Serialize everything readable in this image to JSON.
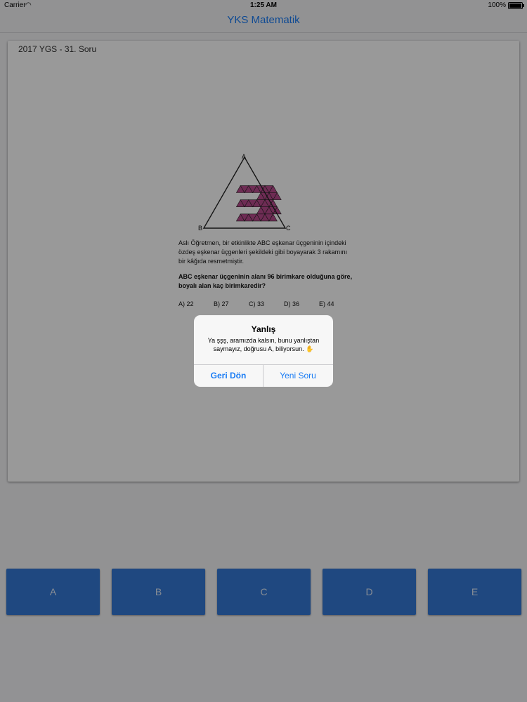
{
  "status_bar": {
    "carrier": "Carrier",
    "time": "1:25 AM",
    "battery": "100%"
  },
  "nav": {
    "title": "YKS Matematik"
  },
  "question_card": {
    "header": "2017 YGS - 31. Soru",
    "figure_labels": {
      "a": "A",
      "b": "B",
      "c": "C"
    },
    "text": "Aslı Öğretmen, bir etkinlikte ABC eşkenar üçgeninin içindeki özdeş eşkenar üçgenleri şekildeki gibi boyayarak 3 rakamını bir kâğıda resmetmiştir.",
    "bold_text": "ABC eşkenar üçgeninin alanı 96 birimkare olduğuna göre, boyalı alan kaç birimkaredir?",
    "options": [
      "A)  22",
      "B)  27",
      "C) 33",
      "D)  36",
      "E)  44"
    ],
    "figure_colors": {
      "shaded": "#b84a8c",
      "stroke": "#222222"
    }
  },
  "alert": {
    "title": "Yanlış",
    "message": "Ya şşş, aramızda kalsın, bunu yanlıştan saymayız, doğrusu A, biliyorsun. ✋",
    "left_button": "Geri Dön",
    "right_button": "Yeni Soru"
  },
  "answer_buttons": [
    "A",
    "B",
    "C",
    "D",
    "E"
  ],
  "colors": {
    "accent": "#1a7cf5",
    "answer_button": "#3579d6"
  }
}
